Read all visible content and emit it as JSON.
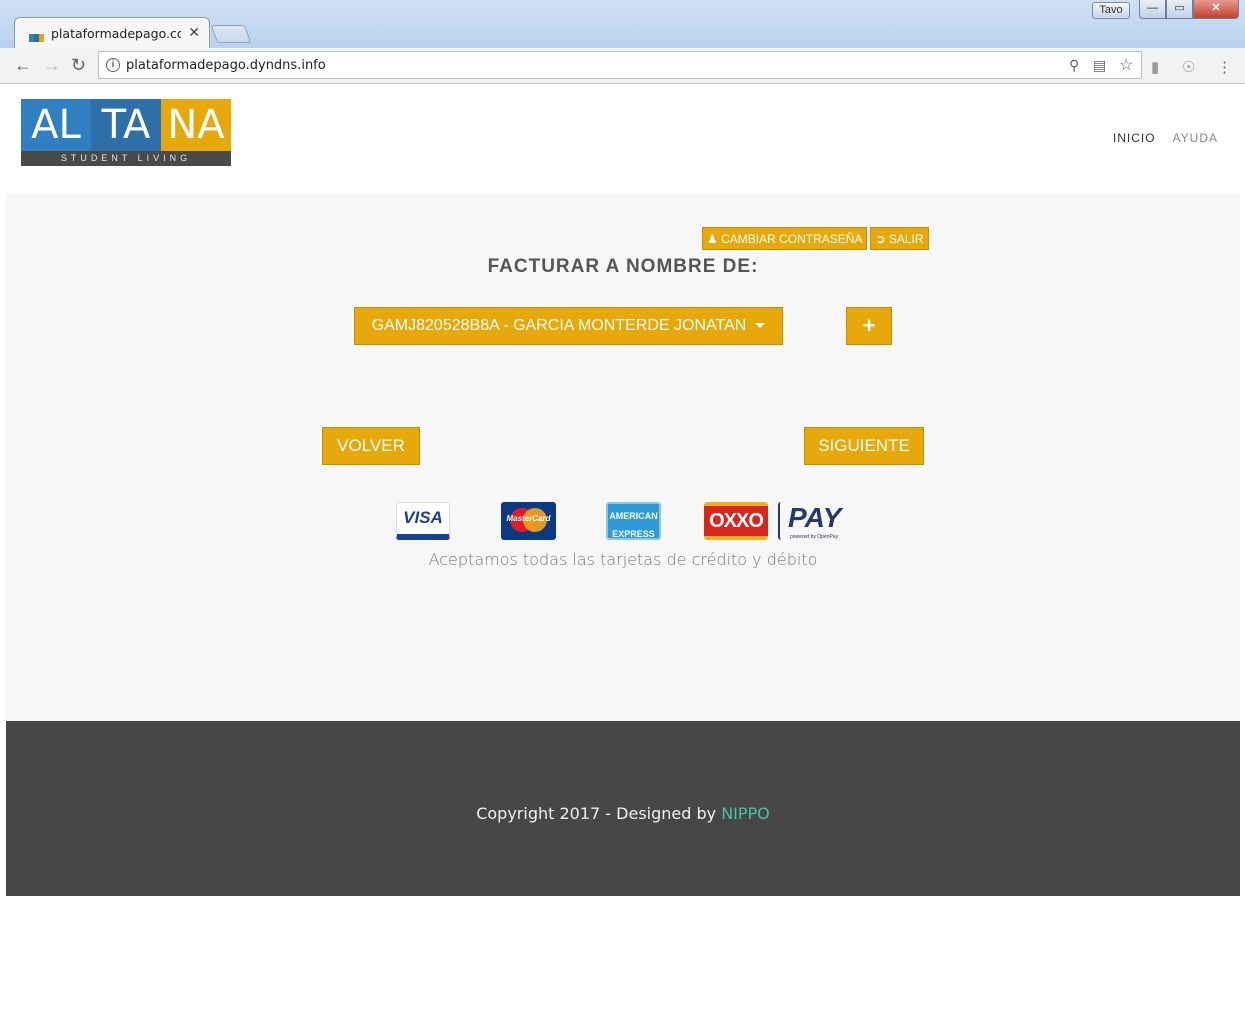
{
  "browser": {
    "tab_title": "plataformadepago.com.m",
    "profile_name": "Tavo",
    "url": "plataformadepago.dyndns.info",
    "window_buttons": {
      "minimize": "—",
      "maximize": "▭",
      "close": "✕"
    }
  },
  "header": {
    "logo": {
      "part1": "AL",
      "part2": "TA",
      "part3": "NA",
      "tagline": "STUDENT LIVING"
    },
    "nav": [
      {
        "label": "INICIO"
      },
      {
        "label": "AYUDA"
      }
    ]
  },
  "main": {
    "change_password_label": "CAMBIAR CONTRASEÑA",
    "logout_label": "SALIR",
    "title": "FACTURAR A NOMBRE DE:",
    "selected_billing": "GAMJ820528B8A - GARCIA MONTERDE JONATAN",
    "add_label": "+",
    "back_label": "VOLVER",
    "next_label": "SIGUIENTE",
    "payment_methods": {
      "visa": "VISA",
      "mastercard": "MasterCard",
      "amex_line1": "AMERICAN",
      "amex_line2": "EXPRESS",
      "oxxo": "OXXO",
      "pay": "PAY",
      "pay_sub": "powered by OpenPay"
    },
    "cards_text": "Aceptamos todas las tarjetas de crédito y débito"
  },
  "footer": {
    "copyright_prefix": "Copyright 2017 - Designed by ",
    "designer": "NIPPO"
  },
  "colors": {
    "accent": "#e6a80a",
    "footer_bg": "#474747",
    "link": "#45c4a8"
  }
}
